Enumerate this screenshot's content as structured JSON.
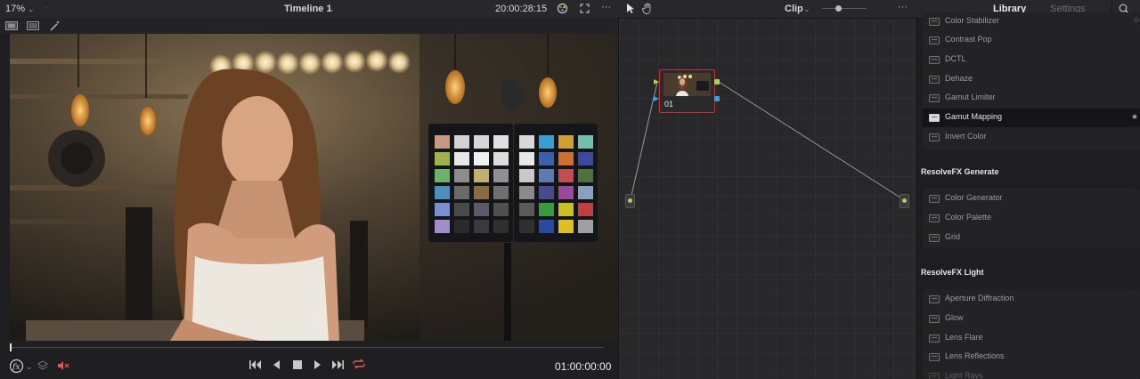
{
  "viewer": {
    "zoom": "17%",
    "timeline_name": "Timeline 1",
    "source_timecode": "20:00:28:15",
    "timecode": "01:00:00:00",
    "more": "···"
  },
  "node_editor": {
    "mode": "Clip",
    "more": "···",
    "node_label": "01"
  },
  "library": {
    "tabs": [
      "Library",
      "Settings"
    ],
    "active_tab": "Library",
    "groups": [
      {
        "title": "",
        "items": [
          "Color Stabilizer",
          "Contrast Pop",
          "DCTL",
          "Dehaze",
          "Gamut Limiter",
          "Gamut Mapping",
          "Invert Color"
        ],
        "selected": "Gamut Mapping"
      },
      {
        "title": "ResolveFX Generate",
        "items": [
          "Color Generator",
          "Color Palette",
          "Grid"
        ]
      },
      {
        "title": "ResolveFX Light",
        "items": [
          "Aperture Diffraction",
          "Glow",
          "Lens Flare",
          "Lens Reflections",
          "Light Rays"
        ]
      }
    ]
  },
  "colors": {
    "accent_red": "#e05a4a",
    "node_border": "#c23434",
    "port_green": "#a7d44a",
    "port_blue": "#3aa0e0"
  }
}
